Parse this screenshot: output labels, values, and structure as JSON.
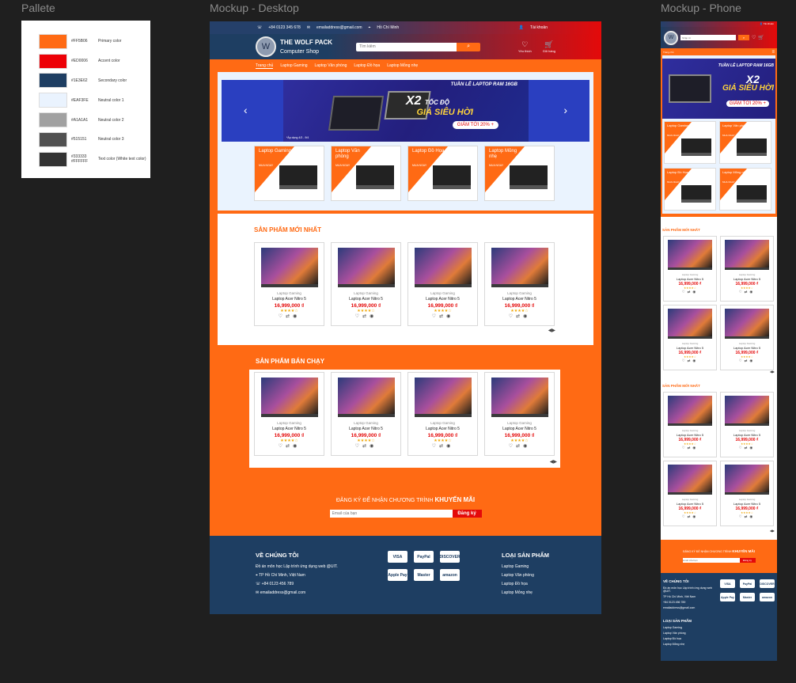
{
  "labels": {
    "palette": "Pallete",
    "desktop": "Mockup - Desktop",
    "phone": "Mockup - Phone"
  },
  "palette": [
    {
      "hex": "#FF5B06",
      "name": "Primary color",
      "color": "#ff6a14"
    },
    {
      "hex": "#ED0006",
      "name": "Accent color",
      "color": "#ed0006"
    },
    {
      "hex": "#1E3E62",
      "name": "Secondary color",
      "color": "#1e3e62"
    },
    {
      "hex": "#EAF3FE",
      "name": "Neutral color 1",
      "color": "#eaf3fe"
    },
    {
      "hex": "#A1A1A1",
      "name": "Neutral color 2",
      "color": "#a1a1a1"
    },
    {
      "hex": "#515151",
      "name": "Neutral color 3",
      "color": "#515151"
    },
    {
      "hex": "#333333 #FFFFFF",
      "name": "Text color (White text color)",
      "color": "#333333"
    }
  ],
  "topbar": {
    "phone": "+84 0123 345 678",
    "email": "emailaddress@gmail.com",
    "location": "Hồ Chí Minh",
    "account": "Tài khoản"
  },
  "brand": {
    "name": "THE WOLF PACK",
    "sub": "Computer Shop",
    "logo": "W"
  },
  "search": {
    "placeholder": "Tìm kiếm",
    "phone_placeholder": "Nhập từ"
  },
  "header_icons": {
    "wishlist": "Yêu thích",
    "cart": "Giỏ hàng"
  },
  "nav": [
    "Trang chủ",
    "Laptop Gaming",
    "Laptop Văn phòng",
    "Laptop Đồ họa",
    "Laptop Mỏng nhẹ"
  ],
  "banner": {
    "title": "TUẦN LỄ LAPTOP RAM 16GB",
    "x2": "X2",
    "x2_sub": "TỐC ĐỘ",
    "sale": "GIÁ SIÊU HỜI",
    "badge": "GIẢM TỚI 20% +",
    "note": "*Áp dụng 4/3 - 9/4"
  },
  "categories": [
    {
      "name": "Laptop Gaming",
      "sub": "MUA NGAY"
    },
    {
      "name": "Laptop Văn phòng",
      "sub": "MUA NGAY"
    },
    {
      "name": "Laptop Đồ Họa",
      "sub": "MUA NGAY"
    },
    {
      "name": "Laptop Mỏng nhẹ",
      "sub": "MUA NGAY"
    }
  ],
  "sections": {
    "new": "SẢN PHẨM MỚI NHẤT",
    "best": "SẢN PHẨM BÁN CHẠY"
  },
  "product": {
    "category": "Laptop Gaming",
    "name": "Laptop Acer Nitro 5",
    "price": "16,999,000 ₫",
    "rating": "★★★★☆",
    "actions": "♡⇄◉"
  },
  "pager": "◀▶",
  "subscribe": {
    "text": "ĐĂNG KÝ ĐỂ NHẬN CHƯƠNG TRÌNH",
    "highlight": "KHUYẾN MÃI",
    "placeholder": "Email của bạn",
    "button": "Đăng ký"
  },
  "footer": {
    "about_title": "VỀ CHÚNG TÔI",
    "about": [
      "Đồ án môn học Lập trình ứng dụng web @UIT.",
      "TP Hồ Chí Minh, Việt Nam",
      "+84 0123 456 789",
      "emailaddress@gmail.com"
    ],
    "cat_title": "LOẠI SẢN PHẨM",
    "cats": [
      "Laptop Gaming",
      "Laptop Văn phòng",
      "Laptop Đồ họa",
      "Laptop Mỏng nhẹ"
    ],
    "payments": [
      "VISA",
      "PayPal",
      "DISCOVER",
      "Apple Pay",
      "Master",
      "amazon"
    ]
  }
}
